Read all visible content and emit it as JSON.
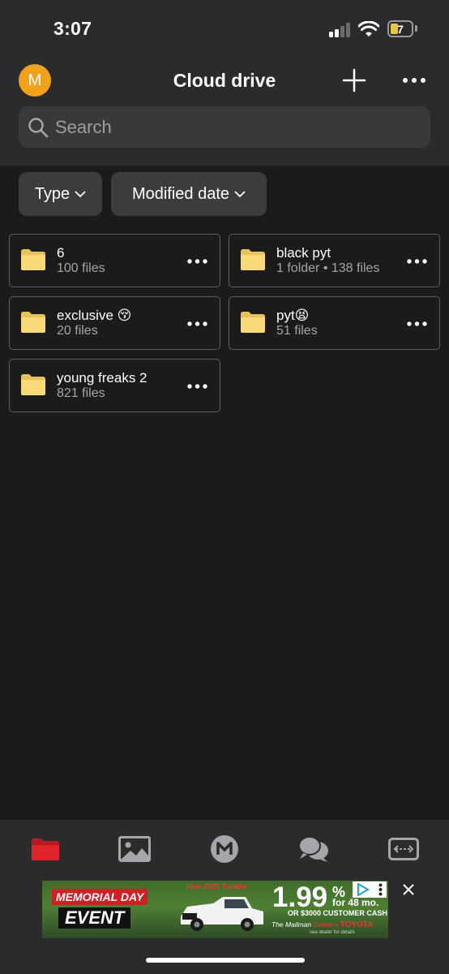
{
  "status_bar": {
    "time": "3:07",
    "battery": "7",
    "battery_color": "#e9c541"
  },
  "header": {
    "avatar_letter": "M",
    "avatar_color": "#f1a21b",
    "title": "Cloud drive",
    "add_icon": "plus-icon",
    "more_icon": "more-horizontal-icon"
  },
  "search": {
    "placeholder": "Search",
    "icon": "search-icon"
  },
  "filters": [
    {
      "label": "Type"
    },
    {
      "label": "Modified date"
    }
  ],
  "folders": [
    {
      "name": "6",
      "meta": "100 files"
    },
    {
      "name": "black pyt",
      "meta": "1 folder • 138 files"
    },
    {
      "name": "exclusive 😚",
      "meta": "20 files"
    },
    {
      "name": "pyt😫",
      "meta": "51 files"
    },
    {
      "name": "young freaks 2",
      "meta": "821 files"
    }
  ],
  "bottom_nav": {
    "tabs": [
      {
        "icon": "folder-icon",
        "active": true
      },
      {
        "icon": "photos-icon",
        "active": false
      },
      {
        "icon": "mega-logo-icon",
        "active": false
      },
      {
        "icon": "chat-icon",
        "active": false
      },
      {
        "icon": "transfers-icon",
        "active": false
      }
    ],
    "active_color": "#e0242c"
  },
  "ad": {
    "event_line1": "MEMORIAL DAY",
    "event_line2": "EVENT",
    "headline": "New 2025 Tundra",
    "rate": "1.99",
    "rate_unit": "%",
    "term": "for 48 mo.",
    "cash": "OR $3000 CUSTOMER CASH",
    "brand_prefix": "The Mailman",
    "brand_accent": "Delivers",
    "brand": "TOYOTA",
    "disclaimer": "see dealer for details"
  }
}
